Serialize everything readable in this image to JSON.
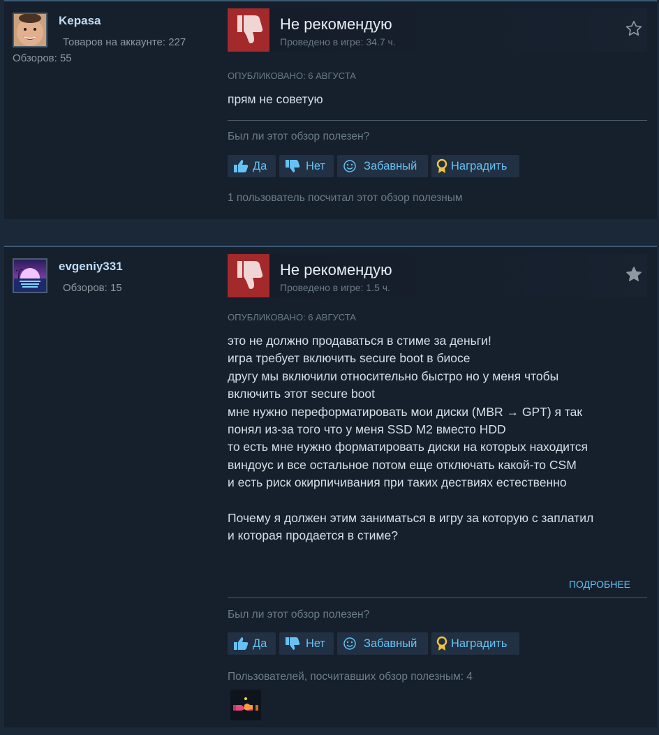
{
  "reviews": [
    {
      "username": "Kepasa",
      "products_label": "Товаров на аккаунте: 227",
      "reviews_label": "Обзоров: 55",
      "verdict": "Не рекомендую",
      "hours": "Проведено в игре: 34.7 ч.",
      "posted": "Опубликовано: 6 августа",
      "body_lines": [
        "прям не советую"
      ],
      "helpful_question": "Был ли этот обзор полезен?",
      "buttons": {
        "yes": "Да",
        "no": "Нет",
        "funny": "Забавный",
        "award": "Наградить"
      },
      "helpful_count": "1 пользователь посчитал этот обзор полезным",
      "star_filled": false
    },
    {
      "username": "evgeniy331",
      "reviews_label": "Обзоров: 15",
      "verdict": "Не рекомендую",
      "hours": "Проведено в игре: 1.5 ч.",
      "posted": "Опубликовано: 6 августа",
      "body_lines": [
        "это не должно продаваться в стиме за деньги!",
        "игра требует включить secure boot в биосе",
        "другу мы включили относительно быстро но у меня чтобы",
        "включить этот secure boot",
        "мне нужно переформатировать мои диски (MBR → GPT) я так",
        "понял из-за того что у меня SSD M2 вместо HDD",
        "то есть мне нужно форматировать диски на которых находится",
        "виндоус и все остальное потом еще отключать какой-то CSM",
        "и есть риск окирпичивания при таких дествиях естественно",
        "",
        "Почему я должен этим заниматься в игру за которую с заплатил",
        "и которая продается в стиме?"
      ],
      "read_more": "Подробнее",
      "helpful_question": "Был ли этот обзор полезен?",
      "buttons": {
        "yes": "Да",
        "no": "Нет",
        "funny": "Забавный",
        "award": "Наградить"
      },
      "helpful_count": "Пользователей, посчитавших обзор полезным: 4",
      "star_filled": true
    }
  ],
  "colors": {
    "page_bg": "#1b2838",
    "card_bg": "#16202d",
    "thumb_down_bg": "#a4292b",
    "link_blue": "#67c1f5"
  }
}
